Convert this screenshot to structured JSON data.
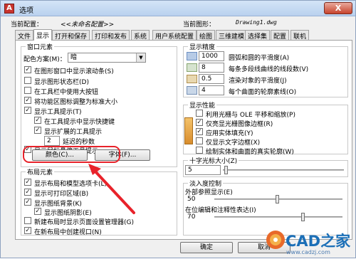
{
  "window": {
    "title": "选项",
    "close_label": "X",
    "app_icon": "A"
  },
  "profile": {
    "label": "当前配置：",
    "value": "<<未命名配置>>"
  },
  "drawing": {
    "label": "当前图形：",
    "value": "Drawing1.dwg"
  },
  "tabs": [
    "文件",
    "显示",
    "打开和保存",
    "打印和发布",
    "系统",
    "用户系统配置",
    "绘图",
    "三维建模",
    "选择集",
    "配置",
    "联机"
  ],
  "active_tab": "显示",
  "window_elements": {
    "legend": "窗口元素",
    "color_scheme_label": "配色方案(M)：",
    "color_scheme_value": "暗",
    "checkboxes": [
      {
        "label": "在图形窗口中显示滚动条(S)",
        "checked": true
      },
      {
        "label": "显示图形状态栏(D)",
        "checked": false
      },
      {
        "label": "在工具栏中使用大按钮",
        "checked": false
      },
      {
        "label": "将功能区图标调整为标准大小",
        "checked": true
      },
      {
        "label": "显示工具提示(T)",
        "checked": true
      },
      {
        "label": "在工具提示中显示快捷键",
        "checked": true
      },
      {
        "label": "显示扩展的工具提示",
        "checked": true
      },
      {
        "label": "显示鼠标悬停工具提示",
        "checked": true
      }
    ],
    "delay_value": "2",
    "delay_label": "延迟的秒数",
    "colors_button": "颜色(C)...",
    "fonts_button": "字体(F)..."
  },
  "layout_elements": {
    "legend": "布局元素",
    "checkboxes": [
      {
        "label": "显示布局和模型选项卡(L)",
        "checked": true
      },
      {
        "label": "显示可打印区域(B)",
        "checked": true
      },
      {
        "label": "显示图纸背景(K)",
        "checked": true
      },
      {
        "label": "显示图纸阴影(E)",
        "checked": true
      },
      {
        "label": "新建布局时显示页面设置管理器(G)",
        "checked": false
      },
      {
        "label": "在新布局中创建视口(N)",
        "checked": true
      }
    ]
  },
  "display_resolution": {
    "legend": "显示精度",
    "rows": [
      {
        "value": "1000",
        "label": "圆弧和圆的平滑度(A)"
      },
      {
        "value": "8",
        "label": "每条多段线曲线的线段数(V)"
      },
      {
        "value": "0.5",
        "label": "渲染对象的平滑度(J)"
      },
      {
        "value": "4",
        "label": "每个曲面的轮廓素线(O)"
      }
    ]
  },
  "display_performance": {
    "legend": "显示性能",
    "checkboxes": [
      {
        "label": "利用光栅与 OLE 平移和缩放(P)",
        "checked": false
      },
      {
        "label": "仅亮显光栅图像边框(R)",
        "checked": true
      },
      {
        "label": "应用实体填充(Y)",
        "checked": true
      },
      {
        "label": "仅显示文字边框(X)",
        "checked": false
      },
      {
        "label": "绘制实体和曲面的真实轮廓(W)",
        "checked": false
      }
    ]
  },
  "crosshair": {
    "legend": "十字光标大小(Z)",
    "value": "5"
  },
  "fade": {
    "legend": "淡入度控制",
    "xref_label": "外部参照显示(E)",
    "xref_value": "50",
    "inplace_label": "在位编辑和注释性表达(I)",
    "inplace_value": "70"
  },
  "buttons": {
    "ok": "确定",
    "cancel": "取消"
  },
  "watermark": {
    "text": "CAD之家",
    "url": "www.cadzj.com"
  },
  "colors": {
    "highlight": "#e8222a",
    "accent": "#1b6fb7",
    "title_bar": "#c9dcf3"
  }
}
